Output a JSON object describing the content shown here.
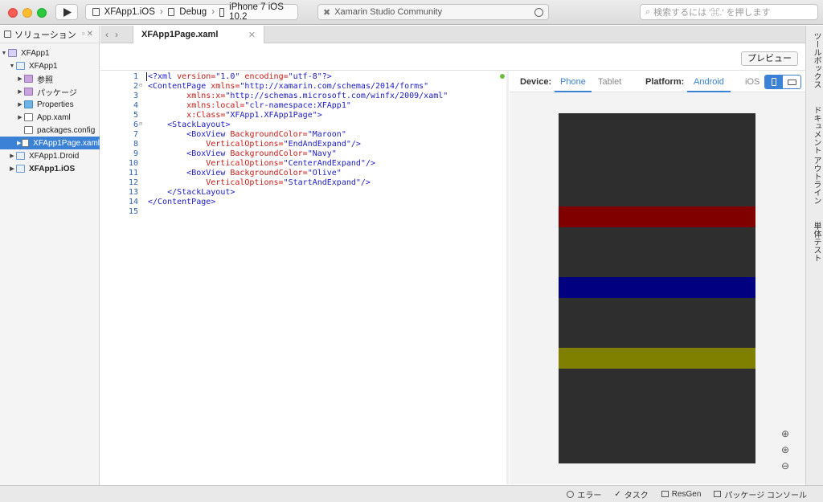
{
  "toolbar": {
    "config": {
      "project": "XFApp1.iOS",
      "configuration": "Debug",
      "device": "iPhone 7 iOS 10.2"
    },
    "status": "Xamarin Studio Community",
    "search_placeholder": "検索するには '⌘.' を押します"
  },
  "sidebar": {
    "title": "ソリューション",
    "items": [
      {
        "label": "XFApp1",
        "icon": "solution-icon"
      },
      {
        "label": "XFApp1",
        "icon": "project-icon"
      },
      {
        "label": "参照",
        "icon": "folder-icon"
      },
      {
        "label": "パッケージ",
        "icon": "folder-icon"
      },
      {
        "label": "Properties",
        "icon": "folder-icon"
      },
      {
        "label": "App.xaml",
        "icon": "file-icon"
      },
      {
        "label": "packages.config",
        "icon": "file-icon"
      },
      {
        "label": "XFApp1Page.xaml",
        "icon": "file-icon",
        "selected": true
      },
      {
        "label": "XFApp1.Droid",
        "icon": "project-icon"
      },
      {
        "label": "XFApp1.iOS",
        "icon": "project-icon",
        "bold": true
      }
    ]
  },
  "editor": {
    "tab_label": "XFApp1Page.xaml",
    "preview_button": "プレビュー",
    "line_numbers": [
      "1",
      "2",
      "3",
      "4",
      "5",
      "6",
      "7",
      "8",
      "9",
      "10",
      "11",
      "12",
      "13",
      "14",
      "15"
    ],
    "code": [
      {
        "tag": "<?xml ",
        "attr": "version=",
        "val": "\"1.0\"",
        "attr2": " encoding=",
        "val2": "\"utf-8\"",
        "tail": "?>"
      },
      {
        "tag": "<ContentPage ",
        "attr": "xmlns=",
        "val": "\"http://xamarin.com/schemas/2014/forms\""
      },
      {
        "indent": "        ",
        "attr": "xmlns:x=",
        "val": "\"http://schemas.microsoft.com/winfx/2009/xaml\""
      },
      {
        "indent": "        ",
        "attr": "xmlns:local=",
        "val": "\"clr-namespace:XFApp1\""
      },
      {
        "indent": "        ",
        "attr": "x:Class=",
        "val": "\"XFApp1.XFApp1Page\"",
        "tail": ">"
      },
      {
        "indent": "    ",
        "tag": "<StackLayout>"
      },
      {
        "indent": "        ",
        "tag": "<BoxView ",
        "attr": "BackgroundColor=",
        "val": "\"Maroon\""
      },
      {
        "indent": "            ",
        "attr": "VerticalOptions=",
        "val": "\"EndAndExpand\"",
        "tail": "/>"
      },
      {
        "indent": "        ",
        "tag": "<BoxView ",
        "attr": "BackgroundColor=",
        "val": "\"Navy\""
      },
      {
        "indent": "            ",
        "attr": "VerticalOptions=",
        "val": "\"CenterAndExpand\"",
        "tail": "/>"
      },
      {
        "indent": "        ",
        "tag": "<BoxView ",
        "attr": "BackgroundColor=",
        "val": "\"Olive\""
      },
      {
        "indent": "            ",
        "attr": "VerticalOptions=",
        "val": "\"StartAndExpand\"",
        "tail": "/>"
      },
      {
        "indent": "    ",
        "tag": "</StackLayout>"
      },
      {
        "tag": "</ContentPage>"
      },
      {
        "tag": ""
      }
    ]
  },
  "preview": {
    "device_label": "Device:",
    "device_options": [
      "Phone",
      "Tablet"
    ],
    "device_selected": "Phone",
    "platform_label": "Platform:",
    "platform_options": [
      "Android",
      "iOS"
    ],
    "platform_selected": "Android",
    "box_colors": {
      "maroon": "#800000",
      "navy": "#000080",
      "olive": "#808000"
    },
    "screen_color": "#2e2e2e",
    "accent": "#3b82d6"
  },
  "right_strip": [
    "ツールボックス",
    "ドキュメント アウトライン",
    "単体テスト"
  ],
  "statusbar": [
    "エラー",
    "タスク",
    "ResGen",
    "パッケージ コンソール"
  ]
}
